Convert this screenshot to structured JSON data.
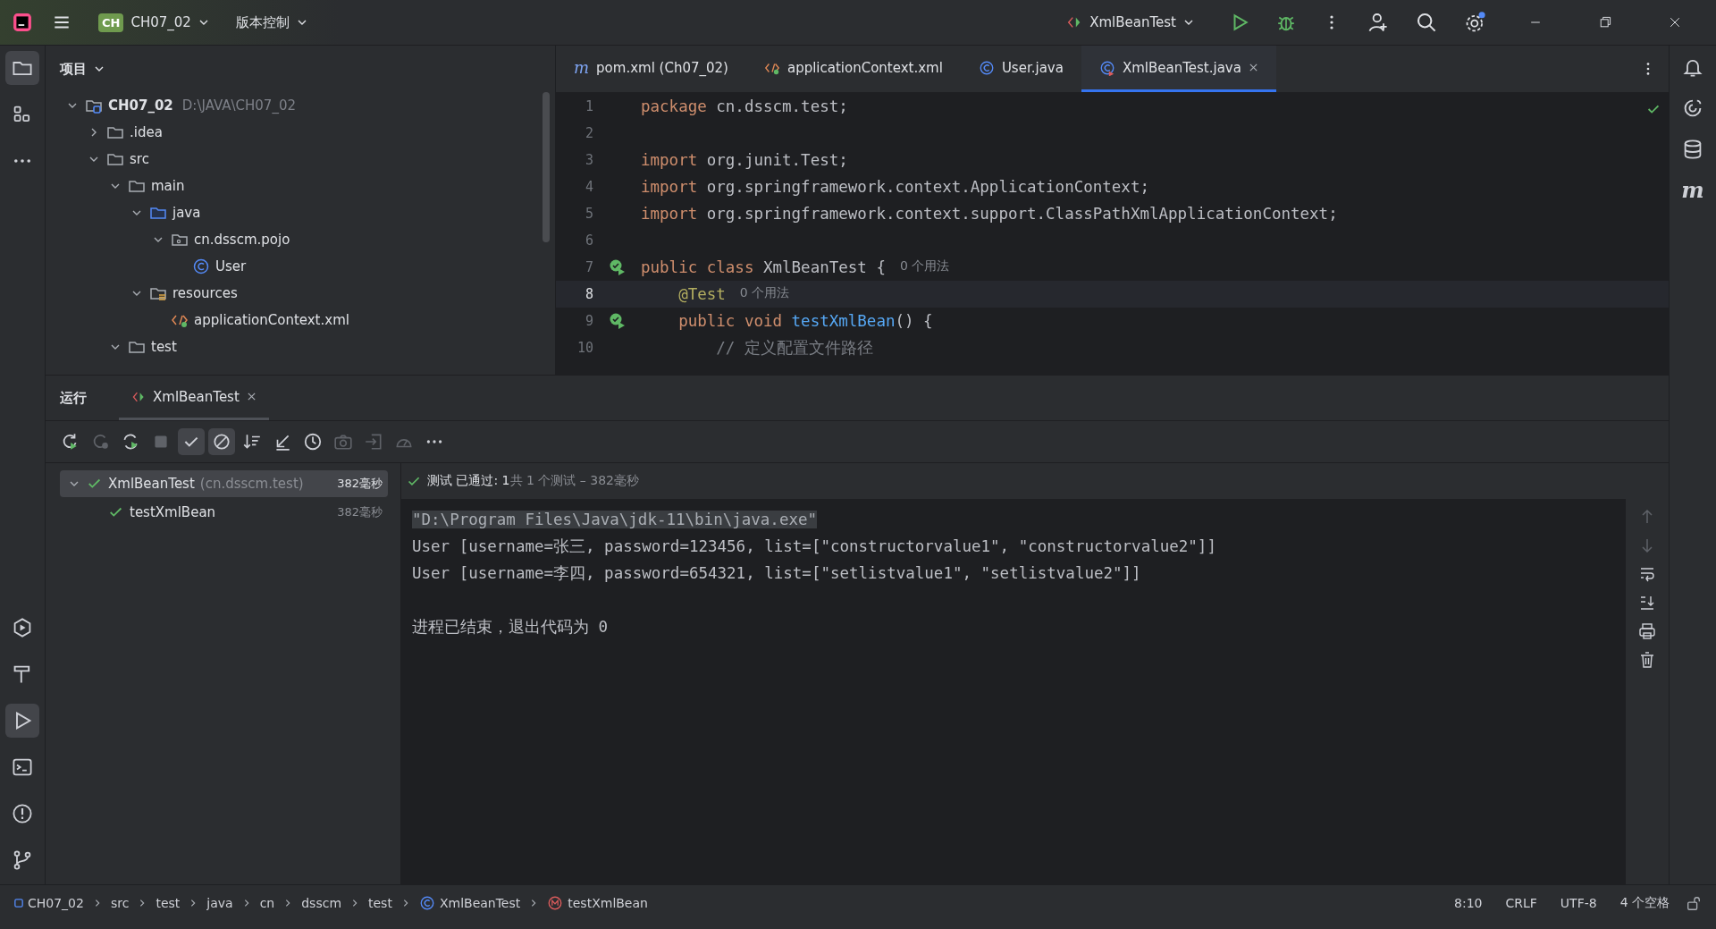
{
  "title_bar": {
    "project_badge": "CH",
    "project": "CH07_02",
    "vcs": "版本控制",
    "run_config": "XmlBeanTest"
  },
  "left_strip": {
    "top": [
      {
        "kind": "folder",
        "selected": true
      },
      {
        "kind": "structure",
        "selected": false
      },
      {
        "kind": "more",
        "selected": false
      }
    ],
    "bottom": [
      {
        "kind": "services",
        "selected": false
      },
      {
        "kind": "build",
        "selected": false
      },
      {
        "kind": "run",
        "selected": true
      },
      {
        "kind": "terminal",
        "selected": false
      },
      {
        "kind": "problems",
        "selected": false
      },
      {
        "kind": "git",
        "selected": false
      }
    ]
  },
  "project_panel": {
    "title": "项目",
    "tree": [
      {
        "kind": "module",
        "label": "CH07_02",
        "path": "D:\\JAVA\\CH07_02",
        "expanded": true,
        "children": [
          {
            "kind": "folder",
            "label": ".idea",
            "expanded": false
          },
          {
            "kind": "folder",
            "label": "src",
            "expanded": true,
            "children": [
              {
                "kind": "folder",
                "label": "main",
                "expanded": true,
                "children": [
                  {
                    "kind": "source",
                    "label": "java",
                    "expanded": true,
                    "children": [
                      {
                        "kind": "package",
                        "label": "cn.dsscm.pojo",
                        "expanded": true,
                        "children": [
                          {
                            "kind": "class",
                            "label": "User"
                          }
                        ]
                      }
                    ]
                  },
                  {
                    "kind": "resources",
                    "label": "resources",
                    "expanded": true,
                    "children": [
                      {
                        "kind": "xml",
                        "label": "applicationContext.xml"
                      }
                    ]
                  }
                ]
              },
              {
                "kind": "folder",
                "label": "test",
                "expanded": true
              }
            ]
          }
        ]
      }
    ]
  },
  "editor": {
    "tabs": [
      {
        "kind": "maven",
        "icon_text": "m",
        "label": "pom.xml (Ch07_02)",
        "selected": false
      },
      {
        "kind": "xml",
        "label": "applicationContext.xml",
        "selected": false
      },
      {
        "kind": "class",
        "label": "User.java",
        "selected": false
      },
      {
        "kind": "test-class",
        "label": "XmlBeanTest.java",
        "selected": true
      }
    ],
    "lines": [
      {
        "num": "1",
        "current": false,
        "run_marker": false,
        "tokens": [
          {
            "kind": "keyword",
            "t": "package "
          },
          {
            "kind": "text",
            "t": "cn.dsscm.test;"
          }
        ]
      },
      {
        "num": "2",
        "current": false,
        "run_marker": false
      },
      {
        "num": "3",
        "current": false,
        "run_marker": false,
        "tokens": [
          {
            "kind": "keyword",
            "t": "import "
          },
          {
            "kind": "text",
            "t": "org.junit.Test;"
          }
        ]
      },
      {
        "num": "4",
        "current": false,
        "run_marker": false,
        "tokens": [
          {
            "kind": "keyword",
            "t": "import "
          },
          {
            "kind": "text",
            "t": "org.springframework.context.ApplicationContext;"
          }
        ]
      },
      {
        "num": "5",
        "current": false,
        "run_marker": false,
        "tokens": [
          {
            "kind": "keyword",
            "t": "import "
          },
          {
            "kind": "text",
            "t": "org.springframework.context.support.ClassPathXmlApplicationContext;"
          }
        ]
      },
      {
        "num": "6",
        "current": false,
        "run_marker": false
      },
      {
        "num": "7",
        "current": false,
        "run_marker": true,
        "tokens": [
          {
            "kind": "keyword",
            "t": "public class "
          },
          {
            "kind": "text",
            "t": "XmlBeanTest {"
          },
          {
            "kind": "hint",
            "t": "0 个用法"
          }
        ]
      },
      {
        "num": "8",
        "current": true,
        "run_marker": false,
        "tokens": [
          {
            "kind": "annotation",
            "t": "    @Test"
          },
          {
            "kind": "hint",
            "t": "0 个用法"
          }
        ]
      },
      {
        "num": "9",
        "current": false,
        "run_marker": true,
        "tokens": [
          {
            "kind": "keyword",
            "t": "    public void "
          },
          {
            "kind": "method",
            "t": "testXmlBean"
          },
          {
            "kind": "text",
            "t": "() {"
          }
        ]
      },
      {
        "num": "10",
        "current": false,
        "run_marker": false,
        "tokens": [
          {
            "kind": "comment",
            "t": "        // 定义配置文件路径"
          }
        ]
      }
    ]
  },
  "right_strip": [
    {
      "kind": "notifications"
    },
    {
      "kind": "ai"
    },
    {
      "kind": "database"
    },
    {
      "kind": "maven",
      "icon_text": "m"
    }
  ],
  "run_panel": {
    "title": "运行",
    "tab": "XmlBeanTest",
    "toolbar": [
      {
        "kind": "rerun",
        "on": false,
        "disabled": false
      },
      {
        "kind": "rerun-failed",
        "on": false,
        "disabled": true
      },
      {
        "kind": "auto-rerun",
        "on": false,
        "disabled": false
      },
      {
        "kind": "stop",
        "on": false,
        "disabled": true
      },
      {
        "kind": "show-passed",
        "on": true,
        "disabled": false
      },
      {
        "kind": "show-ignored",
        "on": true,
        "disabled": false
      },
      {
        "kind": "sort",
        "on": false,
        "disabled": false
      },
      {
        "kind": "collapse",
        "on": false,
        "disabled": false
      },
      {
        "kind": "history",
        "on": false,
        "disabled": false
      },
      {
        "kind": "camera",
        "on": false,
        "disabled": true
      },
      {
        "kind": "import",
        "on": false,
        "disabled": true
      },
      {
        "kind": "gauge",
        "on": false,
        "disabled": true
      },
      {
        "kind": "more",
        "on": false,
        "disabled": false
      }
    ],
    "tests": [
      {
        "label": "XmlBeanTest",
        "detail": "(cn.dsscm.test)",
        "time": "382毫秒",
        "passed": true,
        "selected": true,
        "children": [
          {
            "label": "testXmlBean",
            "time": "382毫秒",
            "passed": true,
            "selected": false
          }
        ]
      }
    ],
    "summary": {
      "passed": true,
      "status": "测试 已通过: 1",
      "detail": "共 1 个测试 – 382毫秒"
    },
    "console": [
      {
        "kind": "text",
        "text": "\"D:\\Program Files\\Java\\jdk-11\\bin\\java.exe\"",
        "selected": true
      },
      {
        "kind": "text",
        "text": "User [username=张三, password=123456, list=[\"constructorvalue1\", \"constructorvalue2\"]]",
        "selected": false
      },
      {
        "kind": "text",
        "text": "User [username=李四, password=654321, list=[\"setlistvalue1\", \"setlistvalue2\"]]",
        "selected": false
      },
      {
        "kind": "blank"
      },
      {
        "kind": "text",
        "text": "进程已结束，退出代码为 0",
        "selected": false
      }
    ],
    "console_tools": [
      {
        "kind": "up",
        "disabled": true
      },
      {
        "kind": "down",
        "disabled": true
      },
      {
        "kind": "wrap",
        "disabled": false
      },
      {
        "kind": "scroll-end",
        "disabled": false
      },
      {
        "kind": "print",
        "disabled": false
      },
      {
        "kind": "trash",
        "disabled": false
      }
    ]
  },
  "status_bar": {
    "breadcrumbs": [
      {
        "kind": "module",
        "label": "CH07_02"
      },
      {
        "kind": "plain",
        "label": "src"
      },
      {
        "kind": "plain",
        "label": "test"
      },
      {
        "kind": "plain",
        "label": "java"
      },
      {
        "kind": "plain",
        "label": "cn"
      },
      {
        "kind": "plain",
        "label": "dsscm"
      },
      {
        "kind": "plain",
        "label": "test"
      },
      {
        "kind": "class",
        "label": "XmlBeanTest"
      },
      {
        "kind": "method",
        "label": "testXmlBean"
      }
    ],
    "caret": "8:10",
    "line_separator": "CRLF",
    "encoding": "UTF-8",
    "indent": "4 个空格"
  }
}
